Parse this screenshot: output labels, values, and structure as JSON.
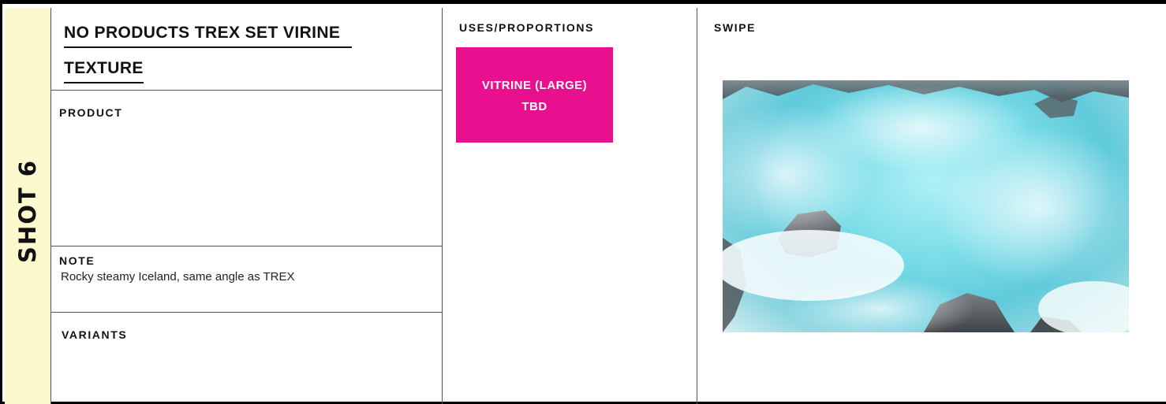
{
  "shot": {
    "label": "SHOT 6"
  },
  "title": {
    "line1": "NO PRODUCTS TREX SET VIRINE",
    "line2": "TEXTURE"
  },
  "product": {
    "label": "PRODUCT"
  },
  "note": {
    "label": "NOTE",
    "text": "Rocky steamy Iceland, same angle as TREX"
  },
  "variants": {
    "label": "VARIANTS"
  },
  "uses": {
    "label": "USES/PROPORTIONS",
    "tag_line1": "VITRINE (LARGE)",
    "tag_line2": "TBD",
    "tag_color": "#e8108e"
  },
  "swipe": {
    "label": "SWIPE",
    "image_subject": "steamy turquoise geothermal pool with dark rocks"
  },
  "colors": {
    "shot_strip_bg": "#fdf9cf",
    "border": "#000000"
  }
}
